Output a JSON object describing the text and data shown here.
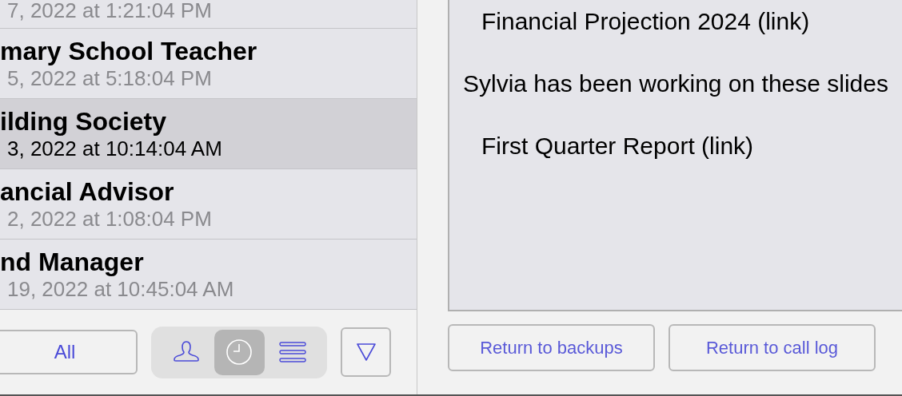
{
  "list": {
    "items": [
      {
        "date": "7, 2022 at 1:21:04 PM",
        "selected": false
      },
      {
        "title": "mary School Teacher",
        "date": "5, 2022 at 5:18:04 PM",
        "selected": false
      },
      {
        "title": "ilding Society",
        "date": "3, 2022 at 10:14:04 AM",
        "selected": true
      },
      {
        "title": "ancial Advisor",
        "date": "2, 2022 at 1:08:04 PM",
        "selected": false
      },
      {
        "title": "nd Manager",
        "date": "19, 2022 at 10:45:04 AM",
        "selected": false
      }
    ]
  },
  "toolbar": {
    "all_button": "All",
    "segments": [
      {
        "kind": "person",
        "selected": false
      },
      {
        "kind": "clock",
        "selected": true
      },
      {
        "kind": "list",
        "selected": false
      }
    ]
  },
  "detail": {
    "lines": [
      {
        "kind": "link",
        "text": "Financial Projection 2024 (link)"
      },
      {
        "kind": "text",
        "text": "Sylvia has been working on these slides"
      },
      {
        "kind": "link",
        "text": "First Quarter Report (link)"
      }
    ]
  },
  "buttons": [
    "Return to backups",
    "Return to call log"
  ]
}
